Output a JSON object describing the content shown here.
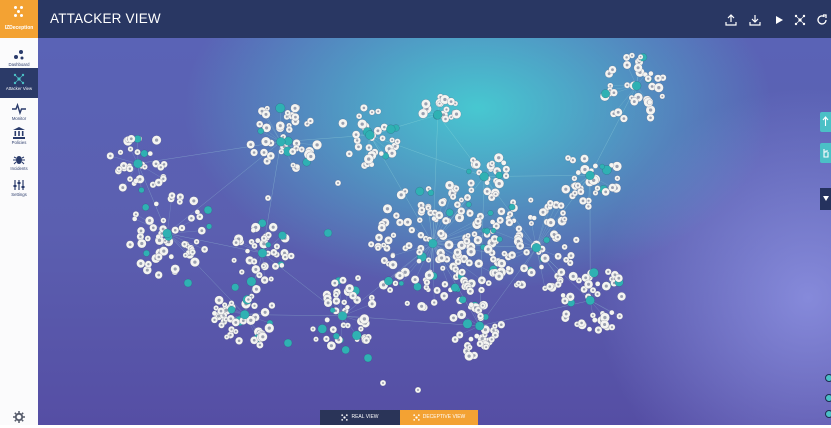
{
  "app": {
    "logo_text": "IZDeception",
    "page_title": "ATTACKER VIEW"
  },
  "sidebar": {
    "items": [
      {
        "label": "Dashboard",
        "icon": "dashboard-icon",
        "active": false
      },
      {
        "label": "Attacker View",
        "icon": "network-icon",
        "active": true
      },
      {
        "label": "Monitor",
        "icon": "pulse-icon",
        "active": false
      },
      {
        "label": "Policies",
        "icon": "bank-icon",
        "active": false
      },
      {
        "label": "Incidents",
        "icon": "bug-icon",
        "active": false
      },
      {
        "label": "Settings",
        "icon": "sliders-icon",
        "active": false
      }
    ],
    "footer_icon": "gear-icon"
  },
  "toolbar": {
    "buttons": [
      "upload-icon",
      "download-icon",
      "play-icon",
      "network-icon",
      "refresh-icon"
    ]
  },
  "bottom_toggle": {
    "real_view_label": "REAL VIEW",
    "deceptive_view_label": "DECEPTIVE VIEW",
    "selected": "deceptive"
  },
  "colors": {
    "accent_orange": "#f3a233",
    "navy": "#293763",
    "teal_node": "#2fb1b3",
    "white_node": "#f4f4f1"
  }
}
